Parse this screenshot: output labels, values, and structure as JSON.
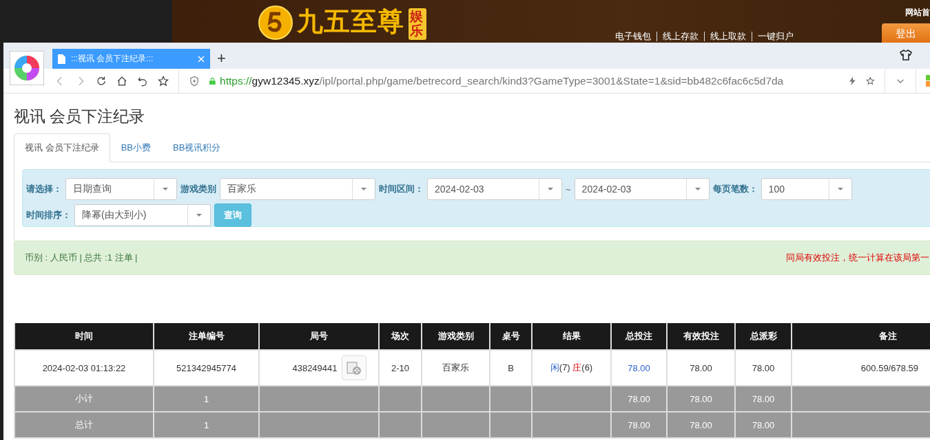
{
  "site_header": {
    "logo_text": "九五至尊",
    "logo_badge": "娱乐",
    "top_link": "网站首",
    "links": [
      "电子钱包",
      "线上存款",
      "线上取款",
      "一键归户"
    ],
    "logout": "登出"
  },
  "browser": {
    "tabs": [
      {
        "title": ":::视讯 会员下注纪录:::",
        "selected": true
      }
    ],
    "new_tab": "+",
    "url": {
      "scheme": "https://",
      "host": "gyw12345.xyz",
      "path": "/ipl/portal.php/game/betrecord_search/kind3?GameType=3001&State=1&sid=bb482c6fac6c5d7da"
    }
  },
  "page": {
    "title": "视讯 会员下注纪录",
    "tabs": [
      {
        "label": "视讯 会员下注纪录",
        "selected": true
      },
      {
        "label": "BB小费",
        "selected": false
      },
      {
        "label": "BB视讯积分",
        "selected": false
      }
    ],
    "filter_rows": [
      [
        {
          "label": "请选择：",
          "value": "日期查询"
        },
        {
          "label": "游戏类别",
          "value": "百家乐"
        },
        {
          "label": "时间区间：",
          "value": "2024-02-03",
          "separator": "~",
          "value_to": "2024-02-03"
        },
        {
          "label": "每页笔数：",
          "value": "100"
        }
      ],
      [
        {
          "label": "时间排序：",
          "value": "降幂(由大到小)"
        }
      ]
    ],
    "search_button": "查询",
    "summary": "币别 : 人民币 | 总共 :1 注单 |",
    "notice": "同局有效投注，统一计算在该局第一",
    "table": {
      "columns": [
        "时间",
        "注单编号",
        "局号",
        "场次",
        "游戏类别",
        "桌号",
        "结果",
        "总投注",
        "有效投注",
        "总派彩",
        "备注"
      ],
      "bet_rows": [
        {
          "time": "2024-02-03 01:13:22",
          "bet_no": "521342945774",
          "round": "438249441",
          "session": "2-10",
          "game": "百家乐",
          "table": "B",
          "result": [
            {
              "kind": "player",
              "label": "闲",
              "score": "(7)"
            },
            {
              "kind": "banker",
              "label": "庄",
              "score": "(6)"
            }
          ],
          "total_bet": "78.00",
          "valid_bet": "78.00",
          "payout": "78.00",
          "remark": "600.59/678.59"
        }
      ],
      "total_rows": [
        {
          "label": "小计",
          "count": "1",
          "total_bet": "78.00",
          "valid_bet": "78.00",
          "payout": "78.00"
        },
        {
          "label": "总计",
          "count": "1",
          "total_bet": "78.00",
          "valid_bet": "78.00",
          "payout": "78.00"
        }
      ]
    }
  }
}
